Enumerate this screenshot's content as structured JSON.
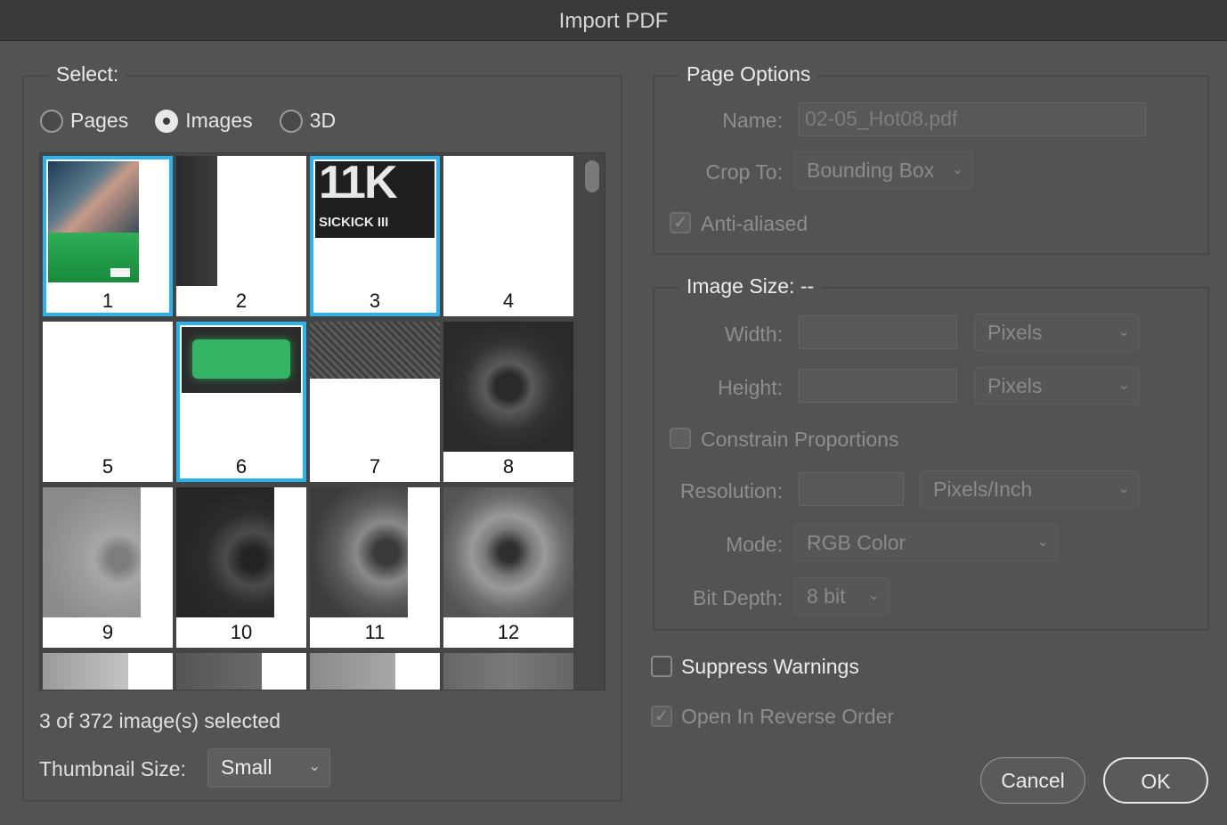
{
  "window": {
    "title": "Import PDF"
  },
  "select": {
    "legend": "Select:",
    "radios": [
      {
        "label": "Pages",
        "checked": false
      },
      {
        "label": "Images",
        "checked": true
      },
      {
        "label": "3D",
        "checked": false
      }
    ],
    "thumbnails": [
      {
        "number": "1",
        "selected": true
      },
      {
        "number": "2",
        "selected": false
      },
      {
        "number": "3",
        "selected": true
      },
      {
        "number": "4",
        "selected": false
      },
      {
        "number": "5",
        "selected": false
      },
      {
        "number": "6",
        "selected": true
      },
      {
        "number": "7",
        "selected": false
      },
      {
        "number": "8",
        "selected": false
      },
      {
        "number": "9",
        "selected": false
      },
      {
        "number": "10",
        "selected": false
      },
      {
        "number": "11",
        "selected": false
      },
      {
        "number": "12",
        "selected": false
      }
    ],
    "thumb3_text": {
      "big": "11K",
      "brand": "SICKICK III"
    },
    "selection_count": "3 of 372 image(s) selected",
    "thumbnail_size_label": "Thumbnail Size:",
    "thumbnail_size_value": "Small"
  },
  "page_options": {
    "legend": "Page Options",
    "name_label": "Name:",
    "name_value": "02-05_Hot08.pdf",
    "crop_label": "Crop To:",
    "crop_value": "Bounding Box",
    "anti_aliased_label": "Anti-aliased",
    "anti_aliased_checked": true
  },
  "image_size": {
    "legend": "Image Size: --",
    "width_label": "Width:",
    "width_unit": "Pixels",
    "height_label": "Height:",
    "height_unit": "Pixels",
    "constrain_label": "Constrain Proportions",
    "constrain_checked": false,
    "resolution_label": "Resolution:",
    "resolution_unit": "Pixels/Inch",
    "mode_label": "Mode:",
    "mode_value": "RGB Color",
    "bitdepth_label": "Bit Depth:",
    "bitdepth_value": "8 bit"
  },
  "options": {
    "suppress_label": "Suppress Warnings",
    "suppress_checked": false,
    "reverse_label": "Open In Reverse Order",
    "reverse_checked": true
  },
  "buttons": {
    "cancel": "Cancel",
    "ok": "OK"
  },
  "colors": {
    "selection": "#2ab4ef",
    "background": "#535353"
  }
}
